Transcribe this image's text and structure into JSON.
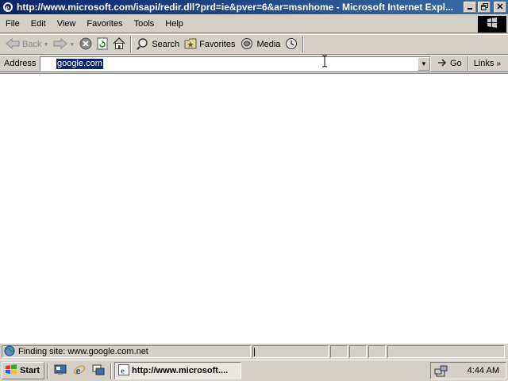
{
  "window": {
    "title": "http://www.microsoft.com/isapi/redir.dll?prd=ie&pver=6&ar=msnhome - Microsoft Internet Expl...",
    "minimize_icon": "minimize-icon",
    "maximize_icon": "restore-icon",
    "close_icon": "close-icon"
  },
  "menu": {
    "items": [
      "File",
      "Edit",
      "View",
      "Favorites",
      "Tools",
      "Help"
    ]
  },
  "toolbar": {
    "back_label": "Back",
    "search_label": "Search",
    "favorites_label": "Favorites",
    "media_label": "Media"
  },
  "address": {
    "label": "Address",
    "value": "google.com",
    "go_label": "Go",
    "links_label": "Links",
    "links_chevron": "»"
  },
  "status": {
    "text": "Finding site: www.google.com.net"
  },
  "taskbar": {
    "start_label": "Start",
    "task_label": "http://www.microsoft....",
    "clock": "4:44 AM"
  },
  "colors": {
    "titlebar_start": "#0a246a",
    "titlebar_end": "#3a6ea5",
    "chrome": "#d4d0c8",
    "selection": "#0a246a"
  }
}
